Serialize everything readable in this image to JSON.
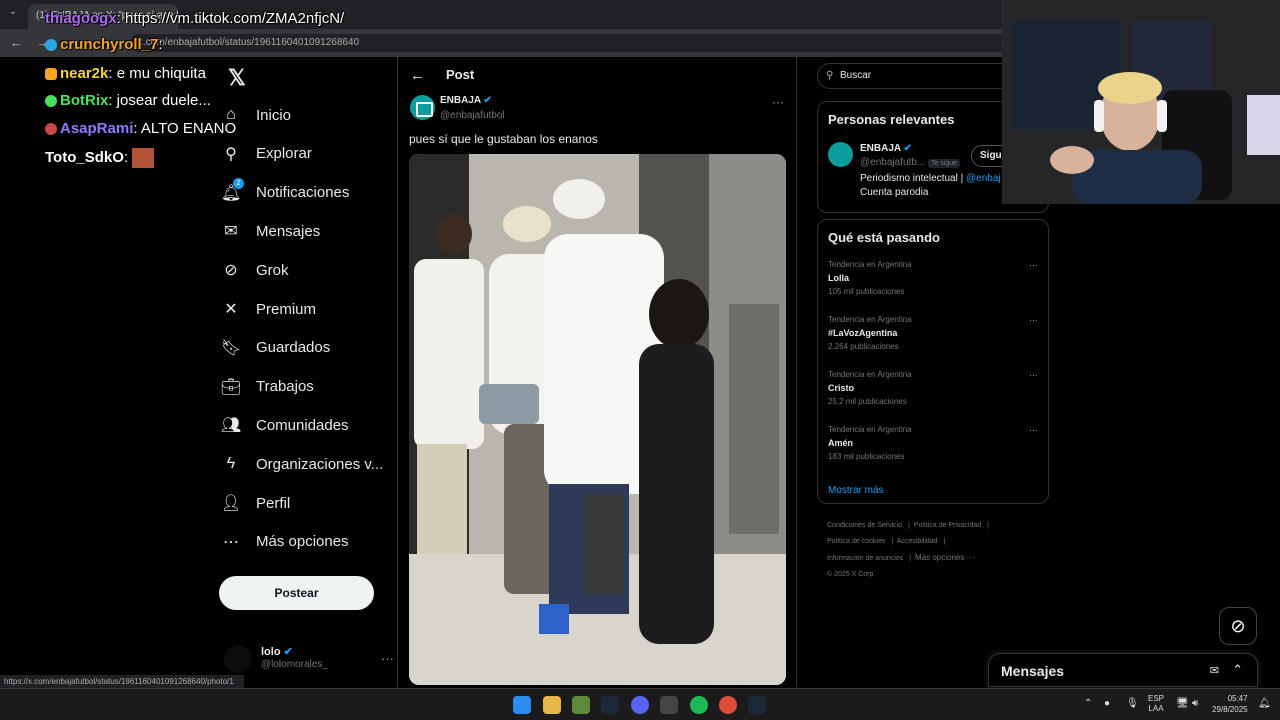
{
  "browser": {
    "tab_title": "(1) ENBAJA en X: \"pues sí que l...",
    "url": "x.com/enbajafutbol/status/1961160401091268640",
    "status_url": "https://x.com/enbajafutbol/status/1961160401091268640/photo/1"
  },
  "chat_overlay": {
    "messages": [
      {
        "user": "thiagoogx",
        "text": ": https://vm.tiktok.com/ZMA2nfjcN/",
        "color": "#b06cf2"
      },
      {
        "user": "crunchyroll_7",
        "text": ":",
        "color": "#f5a623"
      },
      {
        "user": "near2k",
        "text": ": e mu chiquita",
        "color": "#f5d142"
      },
      {
        "user": "BotRix",
        "text": ": josear duele...",
        "color": "#4be05a"
      },
      {
        "user": "AsapRami",
        "text": ": ALTO ENANO",
        "color": "#8b7bff"
      },
      {
        "user": "Toto_SdkO",
        "text": ":",
        "color": "#ffffff"
      }
    ]
  },
  "sidebar": {
    "items": [
      {
        "label": "Inicio",
        "icon": "home-icon",
        "glyph": "⌂"
      },
      {
        "label": "Explorar",
        "icon": "search-icon",
        "glyph": "⚲"
      },
      {
        "label": "Notificaciones",
        "icon": "bell-icon",
        "glyph": "🔔︎",
        "badge": "2"
      },
      {
        "label": "Mensajes",
        "icon": "mail-icon",
        "glyph": "✉"
      },
      {
        "label": "Grok",
        "icon": "grok-icon",
        "glyph": "⊘"
      },
      {
        "label": "Premium",
        "icon": "x-icon",
        "glyph": "✕"
      },
      {
        "label": "Guardados",
        "icon": "bookmark-icon",
        "glyph": "🔖︎"
      },
      {
        "label": "Trabajos",
        "icon": "briefcase-icon",
        "glyph": "💼︎"
      },
      {
        "label": "Comunidades",
        "icon": "people-icon",
        "glyph": "👥︎"
      },
      {
        "label": "Organizaciones v...",
        "icon": "lightning-icon",
        "glyph": "ϟ"
      },
      {
        "label": "Perfil",
        "icon": "person-icon",
        "glyph": "👤︎"
      },
      {
        "label": "Más opciones",
        "icon": "more-circle-icon",
        "glyph": "⋯"
      }
    ],
    "post_button": "Postear",
    "profile": {
      "name": "lolo",
      "handle": "@lolomorales_"
    }
  },
  "main": {
    "header_title": "Post",
    "author_name": "ENBAJA",
    "author_handle": "@enbajafutbol",
    "post_text": "pues sí que le gustaban los enanos"
  },
  "right": {
    "search_placeholder": "Buscar",
    "relevant_title": "Personas relevantes",
    "relevant": {
      "name": "ENBAJA",
      "handle": "@enbajafutb...",
      "follows_you": "Te sigue",
      "follow_btn": "Sigu",
      "bio1": "Periodismo intelectual | ",
      "bio_link": "@enbaj",
      "bio2": "Cuenta parodia"
    },
    "trends_title": "Qué está pasando",
    "trends": [
      {
        "context": "Tendencia en Argentina",
        "name": "Lolla",
        "count": "105 mil publicaciones"
      },
      {
        "context": "Tendencia en Argentina",
        "name": "#LaVozAgentina",
        "count": "2.264 publicaciones"
      },
      {
        "context": "Tendencia en Argentina",
        "name": "Cristo",
        "count": "25,2 mil publicaciones"
      },
      {
        "context": "Tendencia en Argentina",
        "name": "Amén",
        "count": "183 mil publicaciones"
      }
    ],
    "show_more": "Mostrar más",
    "footer": [
      "Condiciones de Servicio",
      "Política de Privacidad",
      "Política de cookies",
      "Accesibilidad",
      "Información de anuncios",
      "Más opciones ···",
      "© 2025 X Corp."
    ]
  },
  "dm": {
    "title": "Mensajes"
  },
  "taskbar": {
    "lang1": "ESP",
    "lang2": "LAA",
    "time": "05:47",
    "date": "29/8/2025"
  },
  "colors": {
    "accent": "#1d9bf0",
    "verified": "#1d9bf0"
  }
}
